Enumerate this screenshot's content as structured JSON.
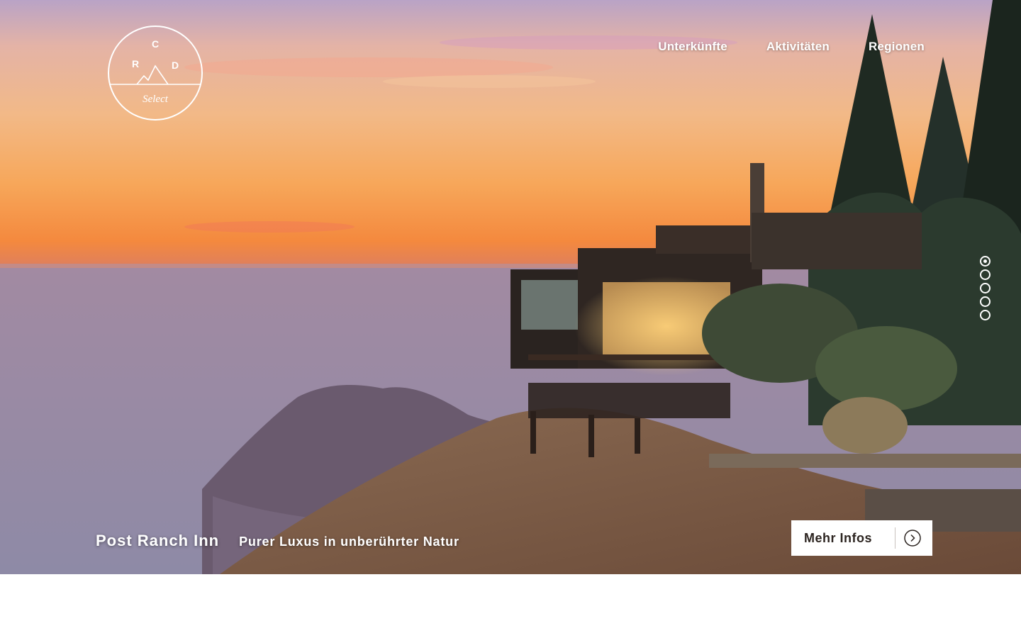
{
  "logo": {
    "letters": [
      "C",
      "R",
      "D"
    ],
    "script_text": "Select"
  },
  "nav": {
    "items": [
      {
        "label": "Unterkünfte"
      },
      {
        "label": "Aktivitäten"
      },
      {
        "label": "Regionen"
      }
    ]
  },
  "slider": {
    "slide_count": 5,
    "active_index": 1
  },
  "caption": {
    "name": "Post Ranch Inn",
    "tagline": "Purer Luxus in unberührter Natur"
  },
  "cta": {
    "label": "Mehr Infos",
    "icon": "chevron-right-circle-icon"
  }
}
